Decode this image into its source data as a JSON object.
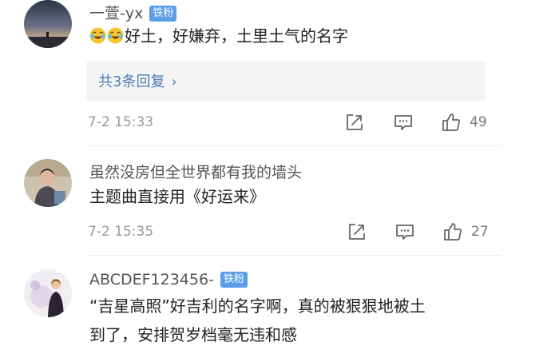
{
  "comments": [
    {
      "username": "一萱-yx",
      "badge": "铁粉",
      "text": "好土，好嫌弃，土里土气的名字",
      "emoji": [
        "laughing-crying-emoji",
        "laughing-crying-emoji"
      ],
      "replies_label": "共3条回复",
      "replies_chevron": "›",
      "time": "7-2 15:33",
      "likes": "49"
    },
    {
      "username": "虽然没房但全世界都有我的墙头",
      "text": "主题曲直接用《好运来》",
      "time": "7-2 15:35",
      "likes": "27"
    },
    {
      "username": "ABCDEF123456-",
      "badge": "铁粉",
      "text_line1": "“吉星高照”好吉利的名字啊，真的被狠狠地被土",
      "text_line2": "到了，安排贺岁档毫无违和感"
    }
  ],
  "icons": {
    "repost": "repost-icon",
    "comment": "comment-icon",
    "like": "thumbs-up-icon"
  },
  "colors": {
    "badge": "#5b9de8",
    "link": "#4b7bb5",
    "meta": "#999999",
    "reply_box": "#f4f4f4"
  }
}
